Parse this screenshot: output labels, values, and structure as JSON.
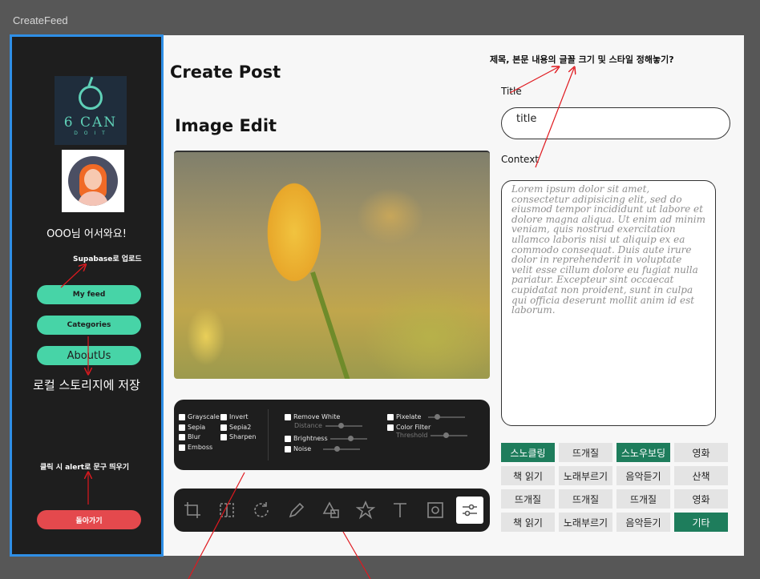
{
  "frame": {
    "label": "CreateFeed"
  },
  "sidebar": {
    "logo": {
      "big": "6 CAN",
      "small": "D O  I T"
    },
    "welcome": "OOO님 어서와요!",
    "buttons": {
      "my_feed": "My feed",
      "categories": "Categories",
      "about": "AboutUs",
      "back": "돌아가기"
    },
    "notes": {
      "supabase": "Supabase로 업로드",
      "local_storage": "로컬 스토리지에 저장",
      "alert": "클릭 시 alert로 문구 띄우기"
    }
  },
  "main": {
    "heading": "Create Post",
    "image_edit_heading": "Image Edit",
    "top_note": "제목, 본문 내용의 글꼴 크기 및 스타일 정해놓기?",
    "title_label": "Title",
    "title_value": "title",
    "context_label": "Context",
    "context_placeholder": "Lorem ipsum dolor sit amet, consectetur adipisicing elit, sed do eiusmod tempor incididunt ut labore et dolore magna aliqua. Ut enim ad minim veniam, quis nostrud exercitation ullamco laboris nisi ut aliquip ex ea commodo consequat. Duis aute irure dolor in reprehenderit in voluptate velit esse cillum dolore eu fugiat nulla pariatur. Excepteur sint occaecat cupidatat non proident, sunt in culpa qui officia deserunt mollit anim id est laborum."
  },
  "filters": {
    "grayscale": "Grayscale",
    "invert": "Invert",
    "sepia": "Sepia",
    "sepia2": "Sepia2",
    "blur": "Blur",
    "sharpen": "Sharpen",
    "emboss": "Emboss",
    "remove_white": "Remove White",
    "distance": "Distance",
    "brightness": "Brightness",
    "noise": "Noise",
    "pixelate": "Pixelate",
    "color_filter": "Color Filter",
    "threshold": "Threshold"
  },
  "tools": [
    "crop-icon",
    "select-icon",
    "rotate-icon",
    "pencil-icon",
    "shapes-icon",
    "star-icon",
    "text-icon",
    "frame-icon",
    "adjust-icon"
  ],
  "tags": [
    {
      "label": "스노클링",
      "selected": true
    },
    {
      "label": "뜨개질",
      "selected": false
    },
    {
      "label": "스노우보딩",
      "selected": true
    },
    {
      "label": "영화",
      "selected": false
    },
    {
      "label": "책 읽기",
      "selected": false
    },
    {
      "label": "노래부르기",
      "selected": false
    },
    {
      "label": "음악듣기",
      "selected": false
    },
    {
      "label": "산책",
      "selected": false
    },
    {
      "label": "뜨개질",
      "selected": false
    },
    {
      "label": "뜨개질",
      "selected": false
    },
    {
      "label": "뜨개질",
      "selected": false
    },
    {
      "label": "영화",
      "selected": false
    },
    {
      "label": "책 읽기",
      "selected": false
    },
    {
      "label": "노래부르기",
      "selected": false
    },
    {
      "label": "음악듣기",
      "selected": false
    },
    {
      "label": "기타",
      "selected": true
    }
  ],
  "colors": {
    "accent": "#47d4a7",
    "selected_tag": "#1e7d5c",
    "danger": "#e4494d",
    "annotation": "#e0191f",
    "sidebar_border": "#2f8fe6"
  }
}
